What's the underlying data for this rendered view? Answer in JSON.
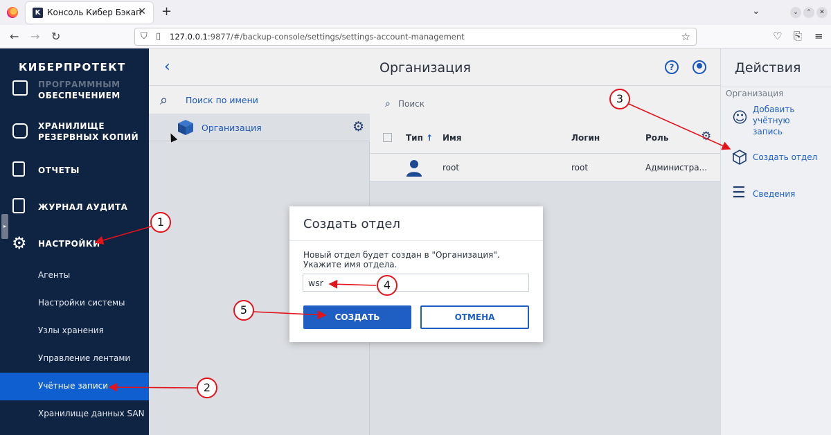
{
  "browser": {
    "tab_title": "Консоль Кибер Бэкап",
    "tab_favicon": "K",
    "new_tab": "+",
    "url_host": "127.0.0.1",
    "url_rest": ":9877/#/backup-console/settings/settings-account-management"
  },
  "sidebar": {
    "brand": "КИБЕРПРОТЕКТ",
    "items": [
      {
        "label": "ПРОГРАММНЫМ ОБЕСПЕЧЕНИЕМ",
        "line1": "ПРОГРАММНЫМ",
        "line2": "ОБЕСПЕЧЕНИЕМ"
      },
      {
        "line1": "ХРАНИЛИЩЕ",
        "line2": "РЕЗЕРВНЫХ КОПИЙ"
      },
      {
        "line1": "ОТЧЕТЫ"
      },
      {
        "line1": "ЖУРНАЛ АУДИТА"
      },
      {
        "line1": "НАСТРОЙКИ"
      }
    ],
    "sub_items": [
      {
        "label": "Агенты"
      },
      {
        "label": "Настройки системы"
      },
      {
        "label": "Узлы хранения"
      },
      {
        "label": "Управление лентами"
      },
      {
        "label": "Учётные записи",
        "active": true
      },
      {
        "label": "Хранилище данных SAN"
      }
    ]
  },
  "tree": {
    "search_placeholder": "Поиск по имени",
    "org_label": "Организация"
  },
  "main": {
    "title": "Организация",
    "search_placeholder": "Поиск",
    "columns": {
      "type": "Тип",
      "sort": "↑",
      "name": "Имя",
      "login": "Логин",
      "role": "Роль"
    },
    "rows": [
      {
        "name": "root",
        "login": "root",
        "role": "Администра..."
      }
    ]
  },
  "actions": {
    "title": "Действия",
    "section": "Организация",
    "items": [
      {
        "line1": "Добавить",
        "line2": "учётную",
        "line3": "запись"
      },
      {
        "line1": "Создать отдел"
      },
      {
        "line1": "Сведения"
      }
    ]
  },
  "modal": {
    "title": "Создать отдел",
    "description": "Новый отдел будет создан в \"Организация\". Укажите имя отдела.",
    "input_value": "wsr",
    "create_label": "СОЗДАТЬ",
    "cancel_label": "ОТМЕНА"
  },
  "callouts": [
    "1",
    "2",
    "3",
    "4",
    "5"
  ],
  "colors": {
    "accent": "#1f5fc4",
    "sidebar": "#0f2342",
    "active": "#0f5fd0",
    "callout": "#e3131b"
  }
}
